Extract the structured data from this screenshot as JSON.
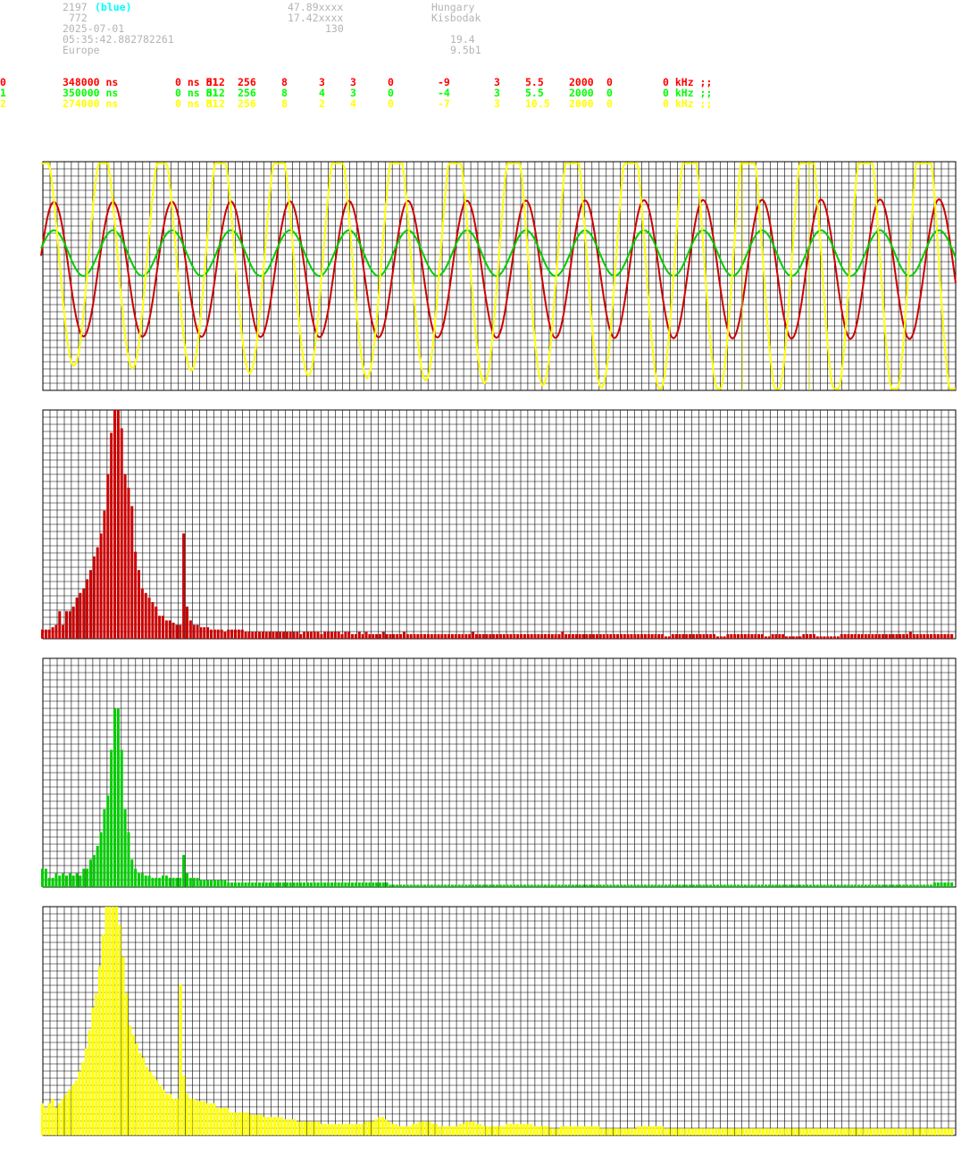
{
  "header": {
    "station_id": "2197",
    "station_color": "(blue)",
    "station_num": "772",
    "date": "2025-07-01",
    "time": "05:35:42.882782261",
    "region": "Europe",
    "lat": "47.89xxxx",
    "lon": "17.42xxxx",
    "alt": "130",
    "country": "Hungary",
    "city": "Kisbodak",
    "val1": "19.4",
    "version": "9.5b1"
  },
  "channels": [
    {
      "c0": "0",
      "c1": "348000 ns",
      "c2": "0 ns H1",
      "c3": "512",
      "c4": "256",
      "c5": "8",
      "c6": "3",
      "c7": "3",
      "c8": "0",
      "c9": "-9",
      "c10": "3",
      "c11": "5.5",
      "c12": "2000",
      "c13": "0",
      "c14": "0 kHz ;;",
      "color": "#ff0000"
    },
    {
      "c0": "1",
      "c1": "350000 ns",
      "c2": "0 ns H1",
      "c3": "512",
      "c4": "256",
      "c5": "8",
      "c6": "4",
      "c7": "3",
      "c8": "0",
      "c9": "-4",
      "c10": "3",
      "c11": "5.5",
      "c12": "2000",
      "c13": "0",
      "c14": "0 kHz ;;",
      "color": "#00ff00"
    },
    {
      "c0": "2",
      "c1": "274000 ns",
      "c2": "0 ns H1",
      "c3": "512",
      "c4": "256",
      "c5": "8",
      "c6": "2",
      "c7": "4",
      "c8": "0",
      "c9": "-7",
      "c10": "3",
      "c11": "10.5",
      "c12": "2000",
      "c13": "0",
      "c14": "0 kHz ;;",
      "color": "#ffff00"
    }
  ],
  "chart_data": [
    {
      "type": "line",
      "grid": true,
      "series": [
        {
          "color": "#cc0000",
          "cycles": 15.5,
          "amplitude": 0.3,
          "offset": 0,
          "phase": 0.2,
          "trend": 0.02
        },
        {
          "color": "#00cc00",
          "cycles": 15.5,
          "amplitude": 0.1,
          "offset": 0.07,
          "phase": 0.2,
          "trend": 0.0
        },
        {
          "color": "#ffff00",
          "cycles": 15.6,
          "amplitude": 0.55,
          "offset": 0.05,
          "phase": 1.2,
          "trend": 0.15
        }
      ]
    },
    {
      "type": "bar",
      "color": "#cc0000",
      "grid": true,
      "values": [
        4,
        4,
        4,
        5,
        6,
        12,
        6,
        12,
        12,
        14,
        18,
        20,
        22,
        26,
        30,
        36,
        40,
        46,
        56,
        72,
        90,
        100,
        100,
        92,
        72,
        66,
        58,
        38,
        30,
        22,
        20,
        18,
        16,
        14,
        10,
        10,
        8,
        8,
        7,
        6,
        6,
        46,
        14,
        8,
        6,
        6,
        5,
        5,
        5,
        4,
        4,
        4,
        4,
        3,
        4,
        4,
        4,
        4,
        4,
        3,
        3,
        3,
        3,
        3,
        3,
        3,
        3,
        3,
        3,
        3,
        3,
        3,
        3,
        3,
        3,
        2,
        3,
        3,
        3,
        3,
        3,
        2,
        3,
        3,
        3,
        3,
        3,
        2,
        3,
        3,
        2,
        2,
        3,
        2,
        3,
        2,
        2,
        2,
        2,
        3,
        2,
        2,
        2,
        2,
        2,
        3,
        2,
        2,
        2,
        2,
        2,
        2,
        2,
        2,
        2,
        2,
        2,
        2,
        2,
        2,
        2,
        2,
        2,
        2,
        2,
        3,
        2,
        2,
        2,
        2,
        2,
        2,
        2,
        2,
        2,
        2,
        2,
        2,
        2,
        2,
        2,
        2,
        2,
        2,
        2,
        2,
        2,
        2,
        2,
        2,
        2,
        3,
        2,
        2,
        2,
        2,
        2,
        2,
        2,
        2,
        2,
        2,
        2,
        2,
        2,
        2,
        2,
        2,
        2,
        2,
        2,
        2,
        2,
        2,
        2,
        2,
        2,
        2,
        2,
        2,
        2,
        1,
        1,
        2,
        2,
        2,
        2,
        2,
        2,
        2,
        2,
        2,
        2,
        2,
        2,
        2,
        1,
        1,
        1,
        2,
        2,
        2,
        2,
        2,
        2,
        2,
        2,
        2,
        2,
        2,
        1,
        1,
        2,
        2,
        2,
        2,
        1,
        1,
        1,
        1,
        1,
        2,
        2,
        2,
        2,
        1,
        1,
        1,
        1,
        1,
        1,
        1,
        2,
        2,
        2,
        2,
        2,
        2,
        2,
        2,
        2,
        2,
        2,
        2,
        2,
        2,
        2,
        2,
        2,
        2,
        2,
        2,
        3,
        2,
        2,
        2,
        2,
        2,
        2,
        2,
        2,
        2,
        2,
        2,
        2
      ]
    },
    {
      "type": "bar",
      "color": "#00cc00",
      "grid": true,
      "values": [
        8,
        8,
        4,
        4,
        6,
        5,
        6,
        5,
        6,
        5,
        6,
        5,
        8,
        8,
        12,
        14,
        18,
        24,
        34,
        40,
        60,
        78,
        78,
        60,
        34,
        24,
        12,
        8,
        6,
        6,
        5,
        5,
        4,
        4,
        4,
        5,
        5,
        4,
        4,
        4,
        4,
        14,
        6,
        4,
        4,
        4,
        3,
        3,
        3,
        3,
        3,
        3,
        3,
        3,
        2,
        2,
        2,
        2,
        2,
        2,
        2,
        2,
        2,
        2,
        2,
        2,
        2,
        2,
        2,
        2,
        2,
        2,
        2,
        2,
        2,
        2,
        2,
        2,
        2,
        2,
        2,
        2,
        2,
        2,
        2,
        2,
        2,
        2,
        2,
        2,
        2,
        2,
        2,
        2,
        2,
        2,
        2,
        2,
        2,
        2,
        2,
        1,
        1,
        1,
        1,
        1,
        1,
        1,
        1,
        1,
        1,
        1,
        1,
        1,
        1,
        1,
        1,
        1,
        1,
        1,
        1,
        1,
        1,
        1,
        1,
        1,
        1,
        1,
        1,
        1,
        1,
        1,
        1,
        1,
        1,
        1,
        1,
        1,
        1,
        1,
        1,
        1,
        1,
        1,
        1,
        1,
        1,
        1,
        1,
        1,
        1,
        1,
        1,
        1,
        1,
        1,
        1,
        1,
        1,
        1,
        1,
        1,
        1,
        1,
        1,
        1,
        1,
        1,
        1,
        1,
        1,
        1,
        1,
        1,
        1,
        1,
        1,
        1,
        1,
        1,
        1,
        1,
        1,
        1,
        1,
        1,
        1,
        1,
        1,
        1,
        1,
        1,
        1,
        1,
        1,
        1,
        1,
        1,
        1,
        1,
        1,
        1,
        1,
        1,
        1,
        1,
        1,
        1,
        1,
        1,
        1,
        1,
        1,
        1,
        1,
        1,
        1,
        1,
        1,
        1,
        1,
        1,
        1,
        1,
        1,
        1,
        1,
        1,
        1,
        1,
        1,
        1,
        1,
        1,
        1,
        1,
        1,
        1,
        1,
        1,
        1,
        1,
        1,
        1,
        1,
        1,
        1,
        1,
        1,
        1,
        1,
        1,
        1,
        1,
        1,
        1,
        1,
        1,
        1,
        2,
        2,
        2,
        2,
        2,
        2
      ]
    },
    {
      "type": "bar",
      "color": "#ffff00",
      "grid": true,
      "values": [
        14,
        12,
        14,
        16,
        12,
        14,
        16,
        18,
        20,
        22,
        24,
        28,
        32,
        38,
        46,
        56,
        62,
        74,
        88,
        100,
        100,
        100,
        100,
        92,
        78,
        62,
        48,
        44,
        40,
        36,
        34,
        30,
        28,
        26,
        24,
        22,
        20,
        18,
        18,
        16,
        16,
        66,
        26,
        18,
        16,
        16,
        15,
        15,
        15,
        14,
        14,
        14,
        12,
        12,
        12,
        12,
        10,
        10,
        10,
        10,
        10,
        10,
        9,
        9,
        9,
        9,
        8,
        8,
        8,
        8,
        8,
        8,
        7,
        7,
        7,
        7,
        6,
        6,
        6,
        6,
        6,
        6,
        6,
        5,
        5,
        5,
        5,
        5,
        5,
        5,
        5,
        5,
        5,
        5,
        5,
        5,
        6,
        6,
        6,
        7,
        8,
        8,
        7,
        6,
        5,
        5,
        4,
        4,
        4,
        4,
        5,
        5,
        6,
        6,
        6,
        6,
        5,
        5,
        4,
        4,
        4,
        4,
        4,
        4,
        5,
        5,
        6,
        6,
        6,
        5,
        5,
        4,
        4,
        4,
        4,
        4,
        4,
        4,
        5,
        5,
        5,
        5,
        5,
        5,
        5,
        5,
        4,
        4,
        4,
        4,
        4,
        3,
        3,
        3,
        4,
        4,
        4,
        4,
        4,
        4,
        4,
        4,
        4,
        4,
        4,
        4,
        3,
        3,
        3,
        3,
        3,
        3,
        3,
        3,
        3,
        3,
        3,
        4,
        4,
        4,
        4,
        4,
        4,
        4,
        4,
        3,
        3,
        3,
        3,
        3,
        3,
        3,
        3,
        3,
        3,
        3,
        3,
        3,
        3,
        3,
        3,
        3,
        3,
        3,
        3,
        3,
        3,
        3,
        3,
        3,
        3,
        3,
        3,
        3,
        3,
        3,
        3,
        3,
        3,
        3,
        3,
        3,
        3,
        3,
        3,
        3,
        3,
        3,
        3,
        3,
        3,
        3,
        3,
        3,
        3,
        3,
        3,
        3,
        3,
        3,
        3,
        3,
        3,
        3,
        3,
        3,
        3,
        3,
        3,
        3,
        3,
        3,
        3,
        3,
        3,
        3,
        3,
        3,
        3,
        3,
        3,
        3,
        3,
        3,
        3,
        3,
        3,
        3,
        3,
        3,
        3
      ]
    }
  ]
}
